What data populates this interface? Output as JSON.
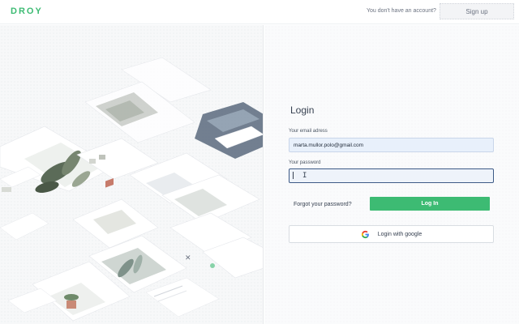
{
  "header": {
    "logo": "DROY",
    "no_account_text": "You don't have an account?",
    "signup_label": "Sign up"
  },
  "colors": {
    "accent": "#3dbb73",
    "focus_border": "#3d5a86",
    "email_bg": "#e8f0fb"
  },
  "login": {
    "title": "Login",
    "email_label": "Your email adress",
    "email_value": "marta.mullor.polo@gmail.com",
    "password_label": "Your password",
    "password_value": "",
    "forgot_label": "Forgot your password?",
    "login_label": "Log In",
    "google_label": "Login with google"
  },
  "icons": {
    "google": "google-icon",
    "text_cursor": "text-cursor-icon"
  }
}
